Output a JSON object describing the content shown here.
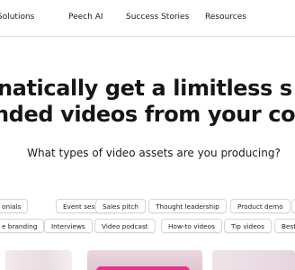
{
  "nav": {
    "items": [
      "Solutions",
      "Peech AI",
      "Success Stories",
      "Resources"
    ]
  },
  "hero": {
    "headline_line1": "natically get a limitless s",
    "headline_line2": "nded videos from your co",
    "subheadline": "What types of video assets are you producing?"
  },
  "chips": {
    "row1": [
      "onials",
      "Event sessions",
      "Sales pitch",
      "Thought leadership",
      "Product demo",
      "E"
    ],
    "row2": [
      "e branding",
      "Interviews",
      "Video podcast",
      "How-to videos",
      "Tip videos",
      "Best"
    ]
  },
  "colors": {
    "accent": "#e8338e",
    "text": "#161616",
    "chip_border": "#d6d6d6"
  }
}
